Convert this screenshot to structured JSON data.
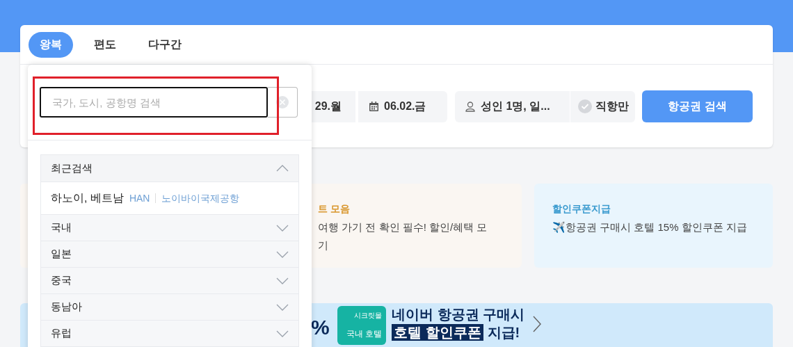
{
  "tabs": [
    {
      "label": "왕복",
      "selected": true
    },
    {
      "label": "편도",
      "selected": false
    },
    {
      "label": "다구간",
      "selected": false
    }
  ],
  "search_bar": {
    "departure_date": "29.월",
    "return_date": "06.02.금",
    "passengers": "성인 1명, 일...",
    "direct_only": {
      "label": "직항만",
      "checked": false
    },
    "search_button": "항공권 검색"
  },
  "promo_cards": [
    {
      "kind": "event",
      "title": "트 모음",
      "lines": [
        "여행 가기 전 확인 필수! 할인/혜택 모",
        "기"
      ]
    },
    {
      "kind": "coupon",
      "title": "할인쿠폰지급",
      "lines": [
        "✈️항공권 구매시 호텔 15% 할인쿠폰 지급"
      ]
    }
  ],
  "banner": {
    "percent": "%",
    "ticket_label": "시크릿몰",
    "ticket_text": "국내 호텔",
    "title": "네이버 항공권 구매시",
    "highlight": "호텔 할인쿠폰",
    "title_end": "지급!"
  },
  "airport_dropdown": {
    "search": {
      "placeholder": "국가, 도시, 공항명 검색"
    },
    "sections": [
      {
        "title": "최근검색",
        "expanded": true,
        "items": [
          {
            "city": "하노이, 베트남",
            "code": "HAN",
            "airport": "노이바이국제공항"
          }
        ]
      },
      {
        "title": "국내",
        "expanded": false
      },
      {
        "title": "일본",
        "expanded": false
      },
      {
        "title": "중국",
        "expanded": false
      },
      {
        "title": "동남아",
        "expanded": false
      },
      {
        "title": "유럽",
        "expanded": false
      }
    ]
  }
}
